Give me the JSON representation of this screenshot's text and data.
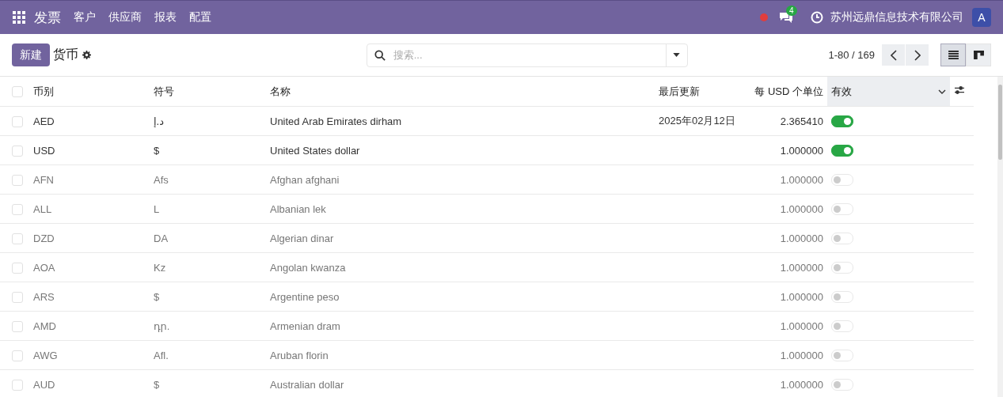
{
  "navbar": {
    "app": "发票",
    "menu": [
      "客户",
      "供应商",
      "报表",
      "配置"
    ],
    "messages_count": "4",
    "company": "苏州远鼎信息技术有限公司",
    "avatar": "A"
  },
  "control_panel": {
    "new_button": "新建",
    "title": "货币",
    "search": {
      "placeholder": "搜索..."
    },
    "pager": "1-80 / 169",
    "views": [
      {
        "kind": "list",
        "selected": true
      },
      {
        "kind": "kanban",
        "selected": false
      }
    ]
  },
  "table": {
    "select_all_checked": false,
    "columns": [
      {
        "label": "币别",
        "sorted": false
      },
      {
        "label": "符号",
        "sorted": false
      },
      {
        "label": "名称",
        "sorted": false
      },
      {
        "label": "最后更新",
        "sorted": false
      },
      {
        "label": "每 USD 个单位",
        "sorted": false
      },
      {
        "label": "有效",
        "sorted": true
      }
    ],
    "rows": [
      {
        "code": "AED",
        "symbol": "د.إ",
        "name": "United Arab Emirates dirham",
        "updated": "2025年02月12日",
        "rate": "2.365410",
        "active": true,
        "checked": false
      },
      {
        "code": "USD",
        "symbol": "$",
        "name": "United States dollar",
        "rate": "1.000000",
        "active": true,
        "checked": false
      },
      {
        "code": "AFN",
        "symbol": "Afs",
        "name": "Afghan afghani",
        "rate": "1.000000",
        "active": false,
        "checked": false
      },
      {
        "code": "ALL",
        "symbol": "L",
        "name": "Albanian lek",
        "rate": "1.000000",
        "active": false,
        "checked": false
      },
      {
        "code": "DZD",
        "symbol": "DA",
        "name": "Algerian dinar",
        "rate": "1.000000",
        "active": false,
        "checked": false
      },
      {
        "code": "AOA",
        "symbol": "Kz",
        "name": "Angolan kwanza",
        "rate": "1.000000",
        "active": false,
        "checked": false
      },
      {
        "code": "ARS",
        "symbol": "$",
        "name": "Argentine peso",
        "rate": "1.000000",
        "active": false,
        "checked": false
      },
      {
        "code": "AMD",
        "symbol": "դր.",
        "name": "Armenian dram",
        "rate": "1.000000",
        "active": false,
        "checked": false
      },
      {
        "code": "AWG",
        "symbol": "Afl.",
        "name": "Aruban florin",
        "rate": "1.000000",
        "active": false,
        "checked": false
      },
      {
        "code": "AUD",
        "symbol": "$",
        "name": "Australian dollar",
        "rate": "1.000000",
        "active": false,
        "checked": false
      }
    ]
  }
}
